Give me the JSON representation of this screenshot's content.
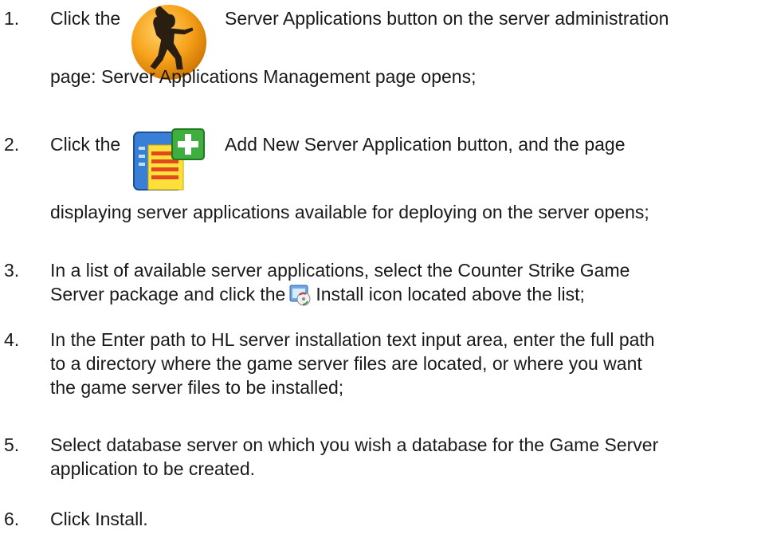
{
  "steps": [
    {
      "number": "1.",
      "icon": "counter-strike-icon",
      "line1_before": "Click the",
      "line1_after": "Server Applications button on the server administration",
      "line2": "page: Server Applications Management page opens;"
    },
    {
      "number": "2.",
      "icon": "add-new-server-application-icon",
      "line1_before": "Click the",
      "line1_after": "Add New Server Application button, and the page",
      "line2": "displaying server applications available for deploying on the server opens;"
    },
    {
      "number": "3.",
      "icon": "install-icon",
      "line1": "In a list of available server applications, select the Counter Strike Game",
      "line2_before": "Server package and click the",
      "line2_after": "Install icon located above the list;"
    },
    {
      "number": "4.",
      "line1": "In the Enter path to HL server installation text input area, enter the full path",
      "line2": "to a directory where the game server files are located, or where you want",
      "line3": "the game server files to be installed;"
    },
    {
      "number": "5.",
      "line1": "Select database server on which you wish a database for the Game Server",
      "line2": "application to be created."
    },
    {
      "number": "6.",
      "line1": "Click Install."
    }
  ]
}
